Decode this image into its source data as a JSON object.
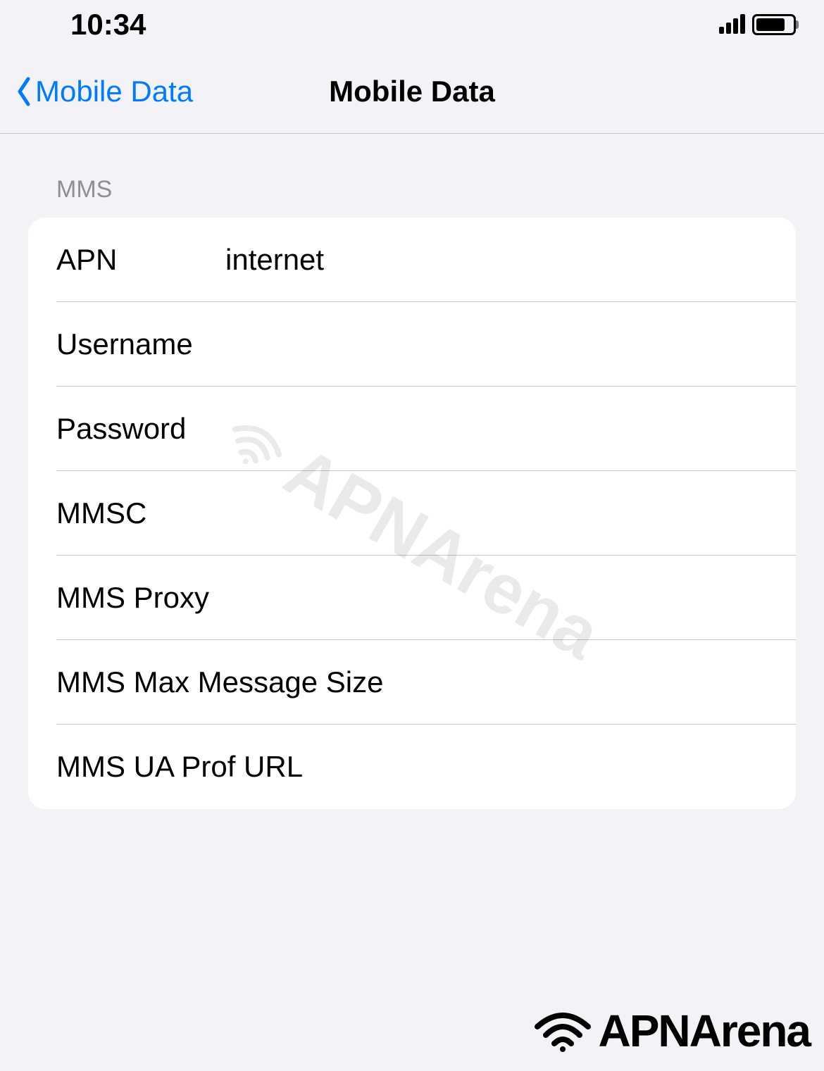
{
  "status_bar": {
    "time": "10:34"
  },
  "nav": {
    "back_label": "Mobile Data",
    "title": "Mobile Data"
  },
  "section": {
    "header": "MMS",
    "rows": [
      {
        "label": "APN",
        "value": "internet"
      },
      {
        "label": "Username",
        "value": ""
      },
      {
        "label": "Password",
        "value": ""
      },
      {
        "label": "MMSC",
        "value": ""
      },
      {
        "label": "MMS Proxy",
        "value": ""
      },
      {
        "label": "MMS Max Message Size",
        "value": ""
      },
      {
        "label": "MMS UA Prof URL",
        "value": ""
      }
    ]
  },
  "branding": {
    "watermark": "APNArena",
    "logo": "APNArena"
  }
}
